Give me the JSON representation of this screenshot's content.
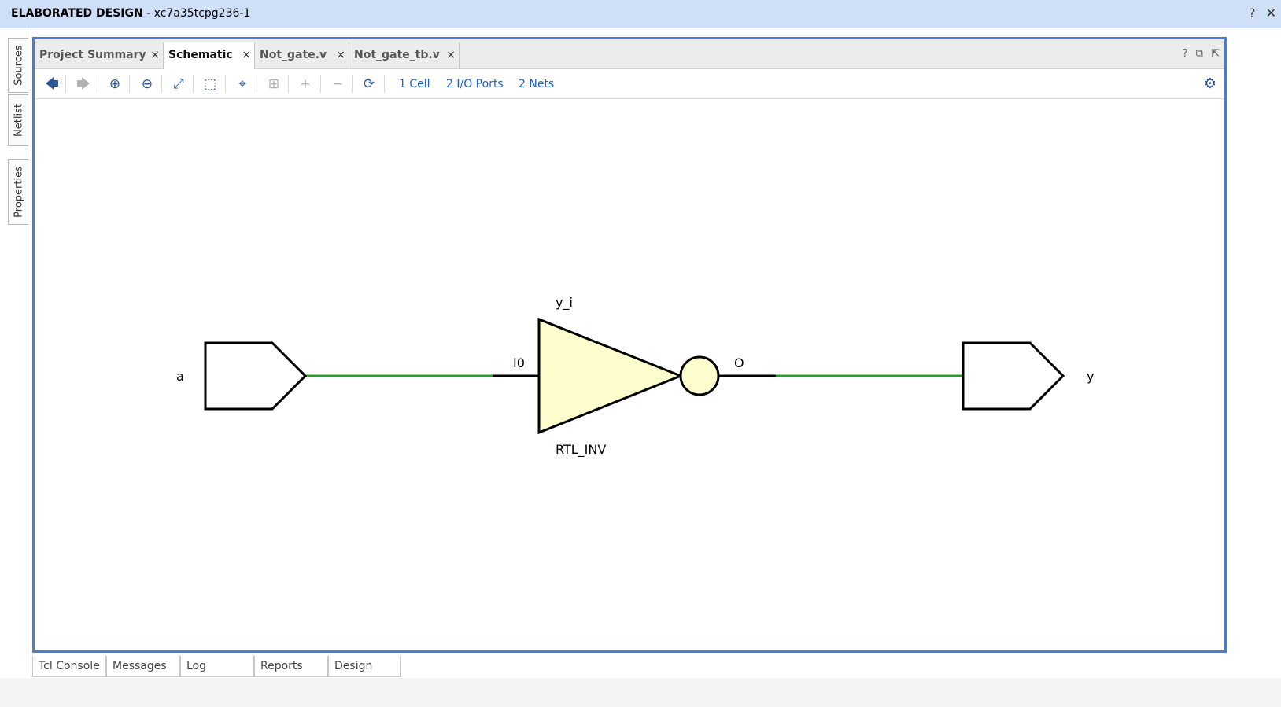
{
  "window": {
    "title_bold": "ELABORATED DESIGN",
    "title_rest": " - xc7a35tcpg236-1",
    "help_icon": "?",
    "close_icon": "✕"
  },
  "side_tabs": [
    "Sources",
    "Netlist",
    "Properties"
  ],
  "tabs": [
    {
      "label": "Project Summary",
      "active": false
    },
    {
      "label": "Schematic",
      "active": true
    },
    {
      "label": "Not_gate.v",
      "active": false
    },
    {
      "label": "Not_gate_tb.v",
      "active": false
    }
  ],
  "tab_close": "×",
  "tabbar_icons": {
    "help": "?",
    "restore": "⧉",
    "float": "⇱"
  },
  "toolbar": {
    "back_icon": "🡄",
    "forward_icon": "🡆",
    "zoom_in_icon": "⊕",
    "zoom_out_icon": "⊖",
    "fit_icon": "⤢",
    "zoom_area_icon": "⬚",
    "select_icon": "⌖",
    "regenerate_icon": "⊞",
    "expand_icon": "+",
    "collapse_icon": "−",
    "refresh_icon": "⟳",
    "settings_icon": "⚙",
    "cells_link": "1 Cell",
    "ports_link": "2 I/O Ports",
    "nets_link": "2 Nets"
  },
  "schematic": {
    "input_port": "a",
    "output_port": "y",
    "cell_instance": "y_i",
    "cell_type": "RTL_INV",
    "input_pin": "I0",
    "output_pin": "O",
    "net_color": "#1fa31f",
    "cell_fill": "#fcfccc"
  },
  "bottom_tabs": [
    "Tcl Console",
    "Messages",
    "Log",
    "Reports",
    "Design Runs"
  ],
  "colors": {
    "title_bg": "#cfdff7",
    "frame_border": "#4c7bd2",
    "link": "#1d5fc4"
  }
}
